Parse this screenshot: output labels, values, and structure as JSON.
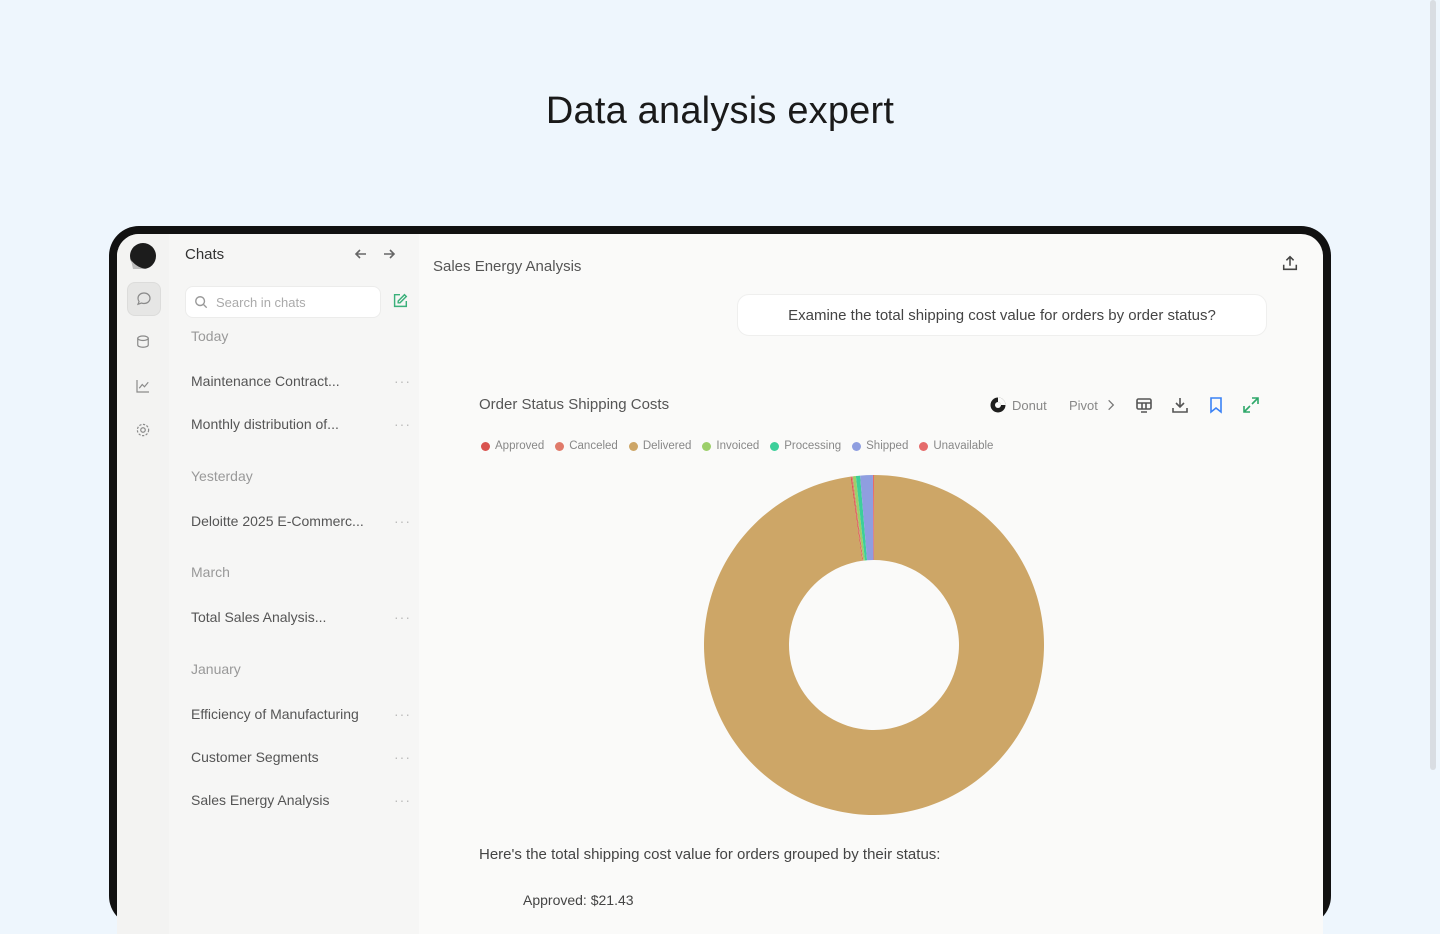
{
  "hero": {
    "title": "Data analysis expert"
  },
  "sidebar": {
    "title": "Chats",
    "search_placeholder": "Search in chats",
    "groups": [
      {
        "label": "Today",
        "items": [
          "Maintenance Contract...",
          "Monthly distribution of..."
        ]
      },
      {
        "label": "Yesterday",
        "items": [
          "Deloitte 2025 E-Commerc..."
        ]
      },
      {
        "label": "March",
        "items": [
          "Total Sales Analysis..."
        ]
      },
      {
        "label": "January",
        "items": [
          "Efficiency of Manufacturing",
          "Customer Segments",
          "Sales Energy Analysis"
        ]
      }
    ],
    "more_glyph": "···"
  },
  "main": {
    "title": "Sales Energy Analysis",
    "user_message": "Examine the total shipping cost value for orders by order status?",
    "answer_intro": "Here's the total shipping cost value for orders grouped by their status:",
    "answer_first_line": "Approved: $21.43"
  },
  "chart_toolbar": {
    "type_label": "Donut",
    "pivot_label": "Pivot"
  },
  "chart_data": {
    "type": "pie",
    "title": "Order Status Shipping Costs",
    "donut": true,
    "legend_position": "top-left",
    "series": [
      {
        "name": "Approved",
        "value": 0.1,
        "color": "#d9534f"
      },
      {
        "name": "Canceled",
        "value": 0.1,
        "color": "#e07a6a"
      },
      {
        "name": "Delivered",
        "value": 97.8,
        "color": "#cda667"
      },
      {
        "name": "Invoiced",
        "value": 0.3,
        "color": "#9ccf6a"
      },
      {
        "name": "Processing",
        "value": 0.4,
        "color": "#3ccf9a"
      },
      {
        "name": "Shipped",
        "value": 1.2,
        "color": "#8f9ee0"
      },
      {
        "name": "Unavailable",
        "value": 0.1,
        "color": "#e56b6b"
      }
    ]
  }
}
